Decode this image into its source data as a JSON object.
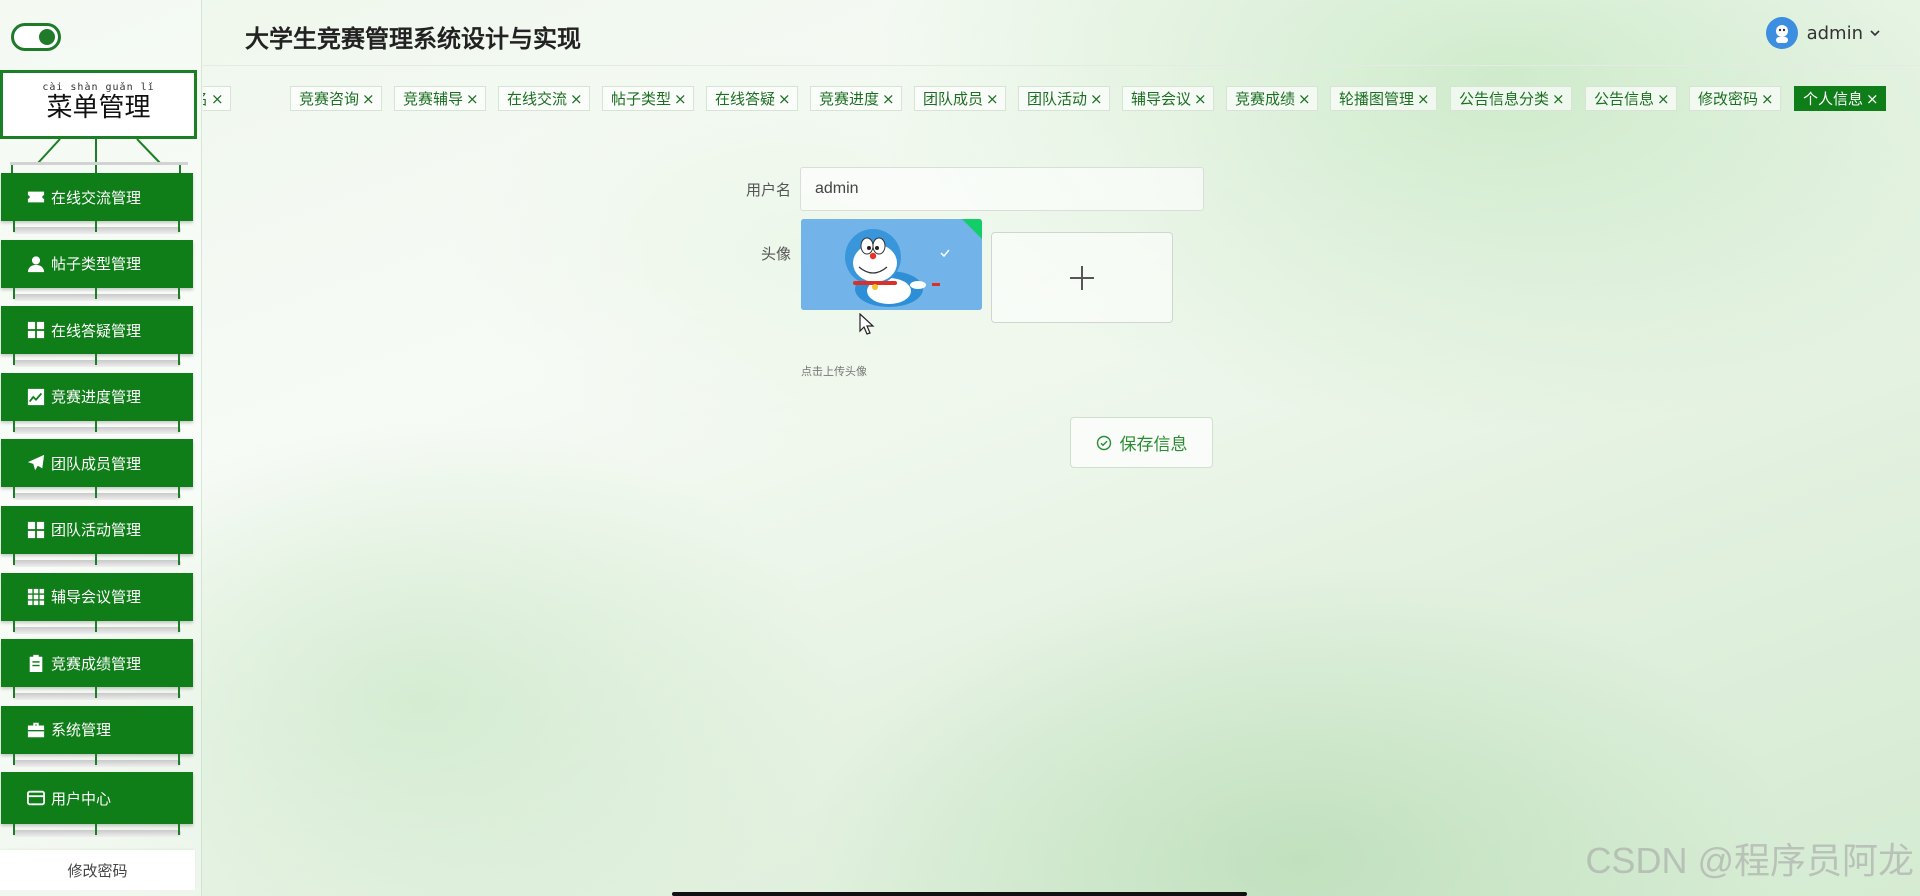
{
  "sidebar": {
    "title_pinyin": "cài shàn guǎn lǐ",
    "title": "菜单管理",
    "items": [
      {
        "label": "在线交流管理",
        "icon": "ticket-icon"
      },
      {
        "label": "帖子类型管理",
        "icon": "user-icon"
      },
      {
        "label": "在线答疑管理",
        "icon": "grid-icon"
      },
      {
        "label": "竞赛进度管理",
        "icon": "chart-icon"
      },
      {
        "label": "团队成员管理",
        "icon": "paper-plane-icon"
      },
      {
        "label": "团队活动管理",
        "icon": "grid-icon"
      },
      {
        "label": "辅导会议管理",
        "icon": "table-grid-icon"
      },
      {
        "label": "竞赛成绩管理",
        "icon": "clipboard-icon"
      },
      {
        "label": "系统管理",
        "icon": "briefcase-icon"
      },
      {
        "label": "用户中心",
        "icon": "card-icon"
      }
    ],
    "change_password": "修改密码"
  },
  "header": {
    "title": "大学生竞赛管理系统设计与实现",
    "user_name": "admin"
  },
  "tabs": [
    {
      "label": "报名"
    },
    {
      "label": "竞赛咨询"
    },
    {
      "label": "竞赛辅导"
    },
    {
      "label": "在线交流"
    },
    {
      "label": "帖子类型"
    },
    {
      "label": "在线答疑"
    },
    {
      "label": "竞赛进度"
    },
    {
      "label": "团队成员"
    },
    {
      "label": "团队活动"
    },
    {
      "label": "辅导会议"
    },
    {
      "label": "竞赛成绩"
    },
    {
      "label": "轮播图管理"
    },
    {
      "label": "公告信息分类"
    },
    {
      "label": "公告信息"
    },
    {
      "label": "修改密码"
    },
    {
      "label": "个人信息",
      "active": true
    }
  ],
  "form": {
    "username_label": "用户名",
    "username_value": "admin",
    "avatar_label": "头像",
    "upload_tip": "点击上传头像",
    "save_label": "保存信息"
  },
  "watermark": "CSDN @程序员阿龙",
  "colors": {
    "primary_green": "#0f7d18",
    "tab_text": "#1c6f23"
  }
}
